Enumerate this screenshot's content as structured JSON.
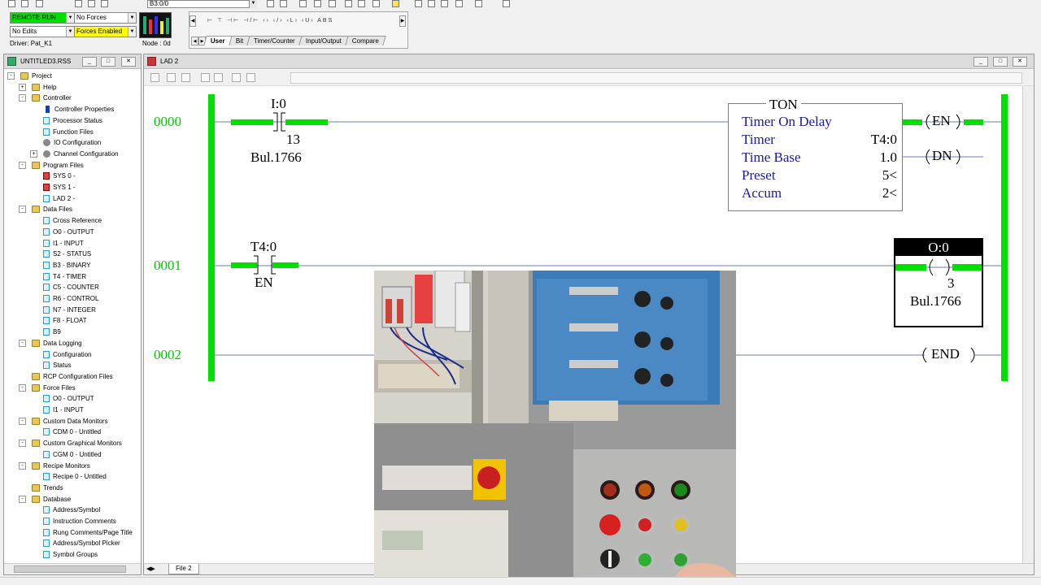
{
  "toolbar": {
    "address": "B3:0/0"
  },
  "status": {
    "run_mode": "REMOTE RUN",
    "forces": "No Forces",
    "edits": "No Edits",
    "forces_enabled": "Forces Enabled",
    "driver": "Driver: Pat_K1",
    "node": "Node :  0d"
  },
  "palette": {
    "icons": "⊢ ⊤ ⊣⊢ ⊣/⊢ ‹› ‹/› ‹L› ‹U› ABS",
    "tabs": [
      "User",
      "Bit",
      "Timer/Counter",
      "Input/Output",
      "Compare"
    ]
  },
  "project": {
    "title": "UNTITLED3.RSS",
    "tree": [
      {
        "label": "Project",
        "level": 0,
        "icon": "folder-open-icon",
        "expander": "-"
      },
      {
        "label": "Help",
        "level": 1,
        "icon": "folder-icon",
        "expander": "+"
      },
      {
        "label": "Controller",
        "level": 1,
        "icon": "folder-icon",
        "expander": "-"
      },
      {
        "label": "Controller Properties",
        "level": 2,
        "icon": "info-icon"
      },
      {
        "label": "Processor Status",
        "level": 2,
        "icon": "tag-icon"
      },
      {
        "label": "Function Files",
        "level": 2,
        "icon": "tag-icon"
      },
      {
        "label": "IO Configuration",
        "level": 2,
        "icon": "io-icon"
      },
      {
        "label": "Channel Configuration",
        "level": 2,
        "icon": "channel-icon",
        "expander": "+"
      },
      {
        "label": "Program Files",
        "level": 1,
        "icon": "folder-icon",
        "expander": "-"
      },
      {
        "label": "SYS 0 -",
        "level": 2,
        "icon": "sys-file-icon"
      },
      {
        "label": "SYS 1 -",
        "level": 2,
        "icon": "sys-file-icon"
      },
      {
        "label": "LAD 2 -",
        "level": 2,
        "icon": "ladder-file-icon"
      },
      {
        "label": "Data Files",
        "level": 1,
        "icon": "folder-icon",
        "expander": "-"
      },
      {
        "label": "Cross Reference",
        "level": 2,
        "icon": "cross-ref-icon"
      },
      {
        "label": "O0 - OUTPUT",
        "level": 2,
        "icon": "data-file-icon"
      },
      {
        "label": "I1 - INPUT",
        "level": 2,
        "icon": "data-file-icon"
      },
      {
        "label": "S2 - STATUS",
        "level": 2,
        "icon": "data-file-icon"
      },
      {
        "label": "B3 - BINARY",
        "level": 2,
        "icon": "data-file-icon"
      },
      {
        "label": "T4 - TIMER",
        "level": 2,
        "icon": "data-file-icon"
      },
      {
        "label": "C5 - COUNTER",
        "level": 2,
        "icon": "data-file-icon"
      },
      {
        "label": "R6 - CONTROL",
        "level": 2,
        "icon": "data-file-icon"
      },
      {
        "label": "N7 - INTEGER",
        "level": 2,
        "icon": "data-file-icon"
      },
      {
        "label": "F8 - FLOAT",
        "level": 2,
        "icon": "data-file-icon"
      },
      {
        "label": "B9",
        "level": 2,
        "icon": "data-file-icon"
      },
      {
        "label": "Data Logging",
        "level": 1,
        "icon": "folder-icon",
        "expander": "-"
      },
      {
        "label": "Configuration",
        "level": 2,
        "icon": "data-file-icon"
      },
      {
        "label": "Status",
        "level": 2,
        "icon": "data-file-icon"
      },
      {
        "label": "RCP Configuration Files",
        "level": 1,
        "icon": "folder-icon"
      },
      {
        "label": "Force Files",
        "level": 1,
        "icon": "folder-icon",
        "expander": "-"
      },
      {
        "label": "O0 - OUTPUT",
        "level": 2,
        "icon": "data-file-icon"
      },
      {
        "label": "I1 - INPUT",
        "level": 2,
        "icon": "data-file-icon"
      },
      {
        "label": "Custom Data Monitors",
        "level": 1,
        "icon": "folder-icon",
        "expander": "-"
      },
      {
        "label": "CDM 0 - Untitled",
        "level": 2,
        "icon": "data-file-icon"
      },
      {
        "label": "Custom Graphical Monitors",
        "level": 1,
        "icon": "folder-icon",
        "expander": "-"
      },
      {
        "label": "CGM 0 - Untitled",
        "level": 2,
        "icon": "data-file-icon"
      },
      {
        "label": "Recipe Monitors",
        "level": 1,
        "icon": "folder-icon",
        "expander": "-"
      },
      {
        "label": "Recipe 0 - Untitled",
        "level": 2,
        "icon": "data-file-icon"
      },
      {
        "label": "Trends",
        "level": 1,
        "icon": "folder-icon"
      },
      {
        "label": "Database",
        "level": 1,
        "icon": "folder-icon",
        "expander": "-"
      },
      {
        "label": "Address/Symbol",
        "level": 2,
        "icon": "db-icon"
      },
      {
        "label": "Instruction Comments",
        "level": 2,
        "icon": "db-icon"
      },
      {
        "label": "Rung Comments/Page Title",
        "level": 2,
        "icon": "db-icon"
      },
      {
        "label": "Address/Symbol Picker",
        "level": 2,
        "icon": "db-icon"
      },
      {
        "label": "Symbol Groups",
        "level": 2,
        "icon": "db-icon"
      }
    ]
  },
  "ladder": {
    "title": "LAD 2",
    "file_tab": "File 2",
    "rungs": [
      "0000",
      "0001",
      "0002"
    ],
    "rung0": {
      "contact_addr": "I:0",
      "contact_bit": "13",
      "contact_desc": "Bul.1766",
      "ton": {
        "name": "TON",
        "desc": "Timer On Delay",
        "timer_label": "Timer",
        "timer_value": "T4:0",
        "timebase_label": "Time Base",
        "timebase_value": "1.0",
        "preset_label": "Preset",
        "preset_value": "5<",
        "accum_label": "Accum",
        "accum_value": "2<"
      },
      "coil_en": "EN",
      "coil_dn": "DN"
    },
    "rung1": {
      "contact_addr": "T4:0",
      "contact_bit": "EN",
      "output_addr": "O:0",
      "output_bit": "3",
      "output_desc": "Bul.1766"
    },
    "rung2": {
      "end": "END"
    }
  },
  "colors": {
    "energized": "#00e000",
    "rung_wire": "#6b7bb0",
    "rung_number": "#00c800"
  }
}
